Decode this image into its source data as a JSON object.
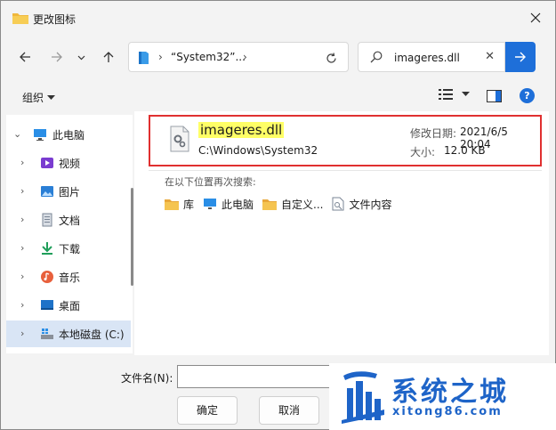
{
  "window": {
    "title": "更改图标"
  },
  "nav": {
    "address_path": "“System32”...",
    "search_value": "imageres.dll"
  },
  "toolbar": {
    "organize_label": "组织"
  },
  "sidebar": {
    "items": [
      {
        "label": "此电脑",
        "icon": "pc-icon"
      },
      {
        "label": "视频",
        "icon": "video-icon"
      },
      {
        "label": "图片",
        "icon": "picture-icon"
      },
      {
        "label": "文档",
        "icon": "document-icon"
      },
      {
        "label": "下载",
        "icon": "download-icon"
      },
      {
        "label": "音乐",
        "icon": "music-icon"
      },
      {
        "label": "桌面",
        "icon": "desktop-icon"
      },
      {
        "label": "本地磁盘 (C:)",
        "icon": "drive-icon"
      }
    ]
  },
  "result": {
    "name": "imageres.dll",
    "path": "C:\\Windows\\System32",
    "modified_label": "修改日期:",
    "modified_value": "2021/6/5 20:04",
    "size_label": "大小:",
    "size_value": "12.0 KB"
  },
  "search_again": {
    "heading": "在以下位置再次搜索:",
    "items": [
      {
        "label": "库",
        "icon": "library-icon"
      },
      {
        "label": "此电脑",
        "icon": "pc-icon"
      },
      {
        "label": "自定义...",
        "icon": "custom-folder-icon"
      },
      {
        "label": "文件内容",
        "icon": "file-content-icon"
      }
    ]
  },
  "bottom": {
    "filename_label": "文件名(N):",
    "filename_value": "",
    "ok_label": "确定",
    "cancel_label": "取消"
  },
  "watermark": {
    "title": "系统之城",
    "url": "xitong86.com"
  },
  "colors": {
    "accent": "#1e6fd9",
    "highlight_border": "#e03030",
    "name_highlight": "#ffff66",
    "watermark": "#1e64c8"
  }
}
